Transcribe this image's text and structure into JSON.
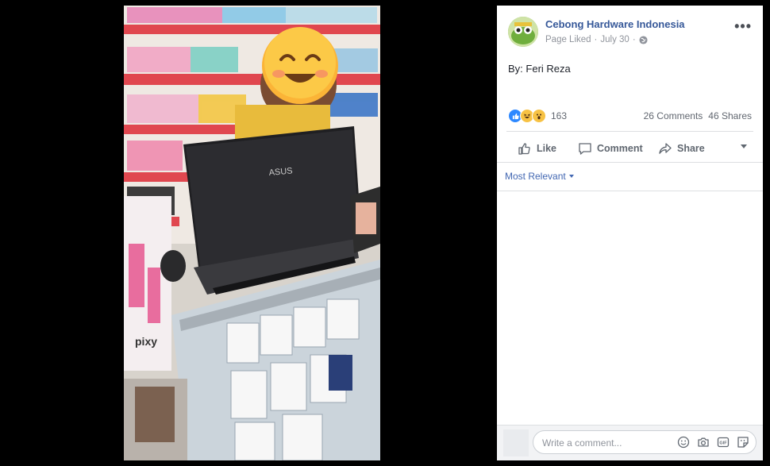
{
  "post": {
    "page_name": "Cebong Hardware Indonesia",
    "page_status": "Page Liked",
    "date": "July 30",
    "dot": "·",
    "body": "By: Feri Reza",
    "reaction_count": "163",
    "comments": "26 Comments",
    "shares": "46 Shares"
  },
  "photo": {
    "laptop_brand": "ASUS",
    "shelf_brand": "pixy"
  },
  "actions": {
    "like": "Like",
    "comment": "Comment",
    "share": "Share"
  },
  "comments_section": {
    "sort_label": "Most Relevant",
    "input_placeholder": "Write a comment..."
  },
  "icons": {
    "more": "ellipsis-icon",
    "audience": "globe-icon",
    "reactions": [
      "like-reaction-icon",
      "haha-reaction-icon",
      "wow-reaction-icon"
    ],
    "composer": [
      "emoji-icon",
      "camera-icon",
      "gif-icon",
      "sticker-icon"
    ]
  },
  "colors": {
    "link": "#365899",
    "accent": "#4267b2",
    "secondary_text": "#90949c",
    "background": "#000000"
  }
}
